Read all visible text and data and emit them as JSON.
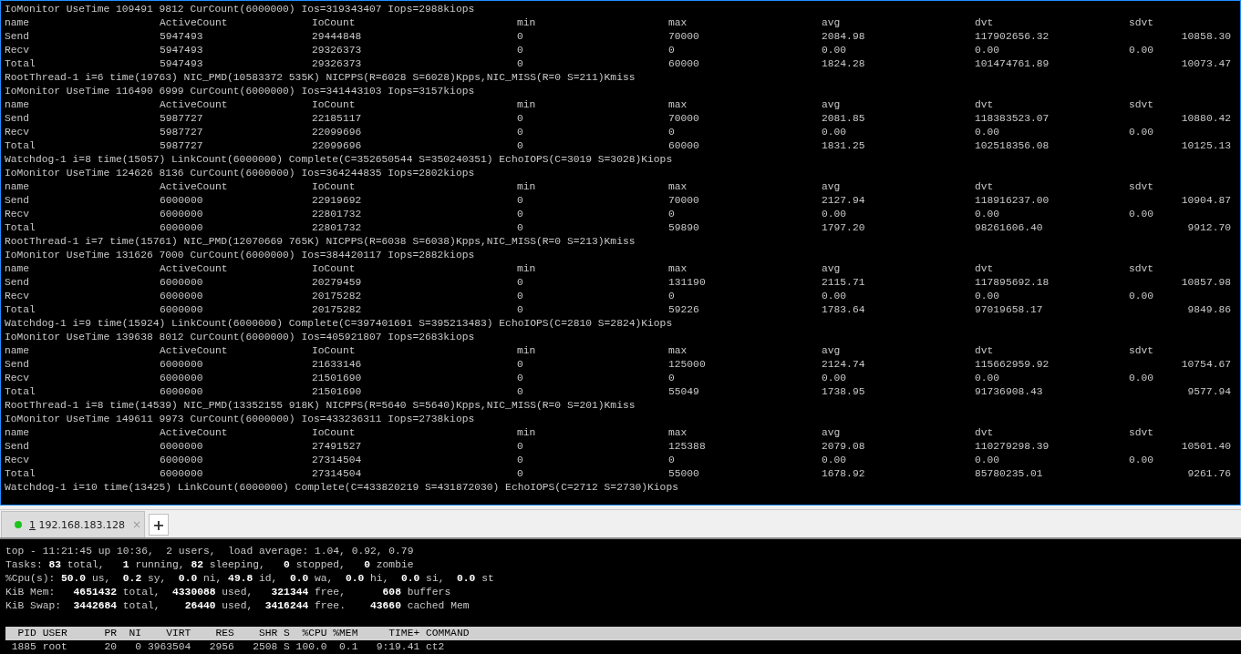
{
  "top_pane": {
    "focused": true,
    "lines": [
      {
        "kind": "text",
        "text": "IoMonitor UseTime 109491 9812 CurCount(6000000) Ios=319343407 Iops=2988kiops"
      },
      {
        "kind": "header",
        "cells": [
          "name",
          "ActiveCount",
          "IoCount",
          "min",
          "max",
          "avg",
          "dvt",
          "sdvt"
        ]
      },
      {
        "kind": "row",
        "cells": [
          "Send",
          "5947493",
          "29444848",
          "0",
          "70000",
          "2084.98",
          "117902656.32"
        ],
        "trailing": "10858.30"
      },
      {
        "kind": "row",
        "cells": [
          "Recv",
          "5947493",
          "29326373",
          "0",
          "0",
          "0.00",
          "0.00",
          "0.00"
        ]
      },
      {
        "kind": "row",
        "cells": [
          "Total",
          "5947493",
          "29326373",
          "0",
          "60000",
          "1824.28",
          "101474761.89"
        ],
        "trailing": "10073.47"
      },
      {
        "kind": "text",
        "text": "RootThread-1 i=6 time(19763) NIC_PMD(10583372 535K) NICPPS(R=6028 S=6028)Kpps,NIC_MISS(R=0 S=211)Kmiss"
      },
      {
        "kind": "text",
        "text": "IoMonitor UseTime 116490 6999 CurCount(6000000) Ios=341443103 Iops=3157kiops"
      },
      {
        "kind": "header",
        "cells": [
          "name",
          "ActiveCount",
          "IoCount",
          "min",
          "max",
          "avg",
          "dvt",
          "sdvt"
        ]
      },
      {
        "kind": "row",
        "cells": [
          "Send",
          "5987727",
          "22185117",
          "0",
          "70000",
          "2081.85",
          "118383523.07"
        ],
        "trailing": "10880.42"
      },
      {
        "kind": "row",
        "cells": [
          "Recv",
          "5987727",
          "22099696",
          "0",
          "0",
          "0.00",
          "0.00",
          "0.00"
        ]
      },
      {
        "kind": "row",
        "cells": [
          "Total",
          "5987727",
          "22099696",
          "0",
          "60000",
          "1831.25",
          "102518356.08"
        ],
        "trailing": "10125.13"
      },
      {
        "kind": "text",
        "text": "Watchdog-1 i=8 time(15057) LinkCount(6000000) Complete(C=352650544 S=350240351) EchoIOPS(C=3019 S=3028)Kiops"
      },
      {
        "kind": "text",
        "text": "IoMonitor UseTime 124626 8136 CurCount(6000000) Ios=364244835 Iops=2802kiops"
      },
      {
        "kind": "header",
        "cells": [
          "name",
          "ActiveCount",
          "IoCount",
          "min",
          "max",
          "avg",
          "dvt",
          "sdvt"
        ]
      },
      {
        "kind": "row",
        "cells": [
          "Send",
          "6000000",
          "22919692",
          "0",
          "70000",
          "2127.94",
          "118916237.00"
        ],
        "trailing": "10904.87"
      },
      {
        "kind": "row",
        "cells": [
          "Recv",
          "6000000",
          "22801732",
          "0",
          "0",
          "0.00",
          "0.00",
          "0.00"
        ]
      },
      {
        "kind": "row",
        "cells": [
          "Total",
          "6000000",
          "22801732",
          "0",
          "59890",
          "1797.20",
          "98261606.40"
        ],
        "trailing": "9912.70"
      },
      {
        "kind": "text",
        "text": "RootThread-1 i=7 time(15761) NIC_PMD(12070669 765K) NICPPS(R=6038 S=6038)Kpps,NIC_MISS(R=0 S=213)Kmiss"
      },
      {
        "kind": "text",
        "text": "IoMonitor UseTime 131626 7000 CurCount(6000000) Ios=384420117 Iops=2882kiops"
      },
      {
        "kind": "header",
        "cells": [
          "name",
          "ActiveCount",
          "IoCount",
          "min",
          "max",
          "avg",
          "dvt",
          "sdvt"
        ]
      },
      {
        "kind": "row",
        "cells": [
          "Send",
          "6000000",
          "20279459",
          "0",
          "131190",
          "2115.71",
          "117895692.18"
        ],
        "trailing": "10857.98"
      },
      {
        "kind": "row",
        "cells": [
          "Recv",
          "6000000",
          "20175282",
          "0",
          "0",
          "0.00",
          "0.00",
          "0.00"
        ]
      },
      {
        "kind": "row",
        "cells": [
          "Total",
          "6000000",
          "20175282",
          "0",
          "59226",
          "1783.64",
          "97019658.17"
        ],
        "trailing": "9849.86"
      },
      {
        "kind": "text",
        "text": "Watchdog-1 i=9 time(15924) LinkCount(6000000) Complete(C=397401691 S=395213483) EchoIOPS(C=2810 S=2824)Kiops"
      },
      {
        "kind": "text",
        "text": "IoMonitor UseTime 139638 8012 CurCount(6000000) Ios=405921807 Iops=2683kiops"
      },
      {
        "kind": "header",
        "cells": [
          "name",
          "ActiveCount",
          "IoCount",
          "min",
          "max",
          "avg",
          "dvt",
          "sdvt"
        ]
      },
      {
        "kind": "row",
        "cells": [
          "Send",
          "6000000",
          "21633146",
          "0",
          "125000",
          "2124.74",
          "115662959.92"
        ],
        "trailing": "10754.67"
      },
      {
        "kind": "row",
        "cells": [
          "Recv",
          "6000000",
          "21501690",
          "0",
          "0",
          "0.00",
          "0.00",
          "0.00"
        ]
      },
      {
        "kind": "row",
        "cells": [
          "Total",
          "6000000",
          "21501690",
          "0",
          "55049",
          "1738.95",
          "91736908.43"
        ],
        "trailing": "9577.94"
      },
      {
        "kind": "text",
        "text": "RootThread-1 i=8 time(14539) NIC_PMD(13352155 918K) NICPPS(R=5640 S=5640)Kpps,NIC_MISS(R=0 S=201)Kmiss"
      },
      {
        "kind": "text",
        "text": "IoMonitor UseTime 149611 9973 CurCount(6000000) Ios=433236311 Iops=2738kiops"
      },
      {
        "kind": "header",
        "cells": [
          "name",
          "ActiveCount",
          "IoCount",
          "min",
          "max",
          "avg",
          "dvt",
          "sdvt"
        ]
      },
      {
        "kind": "row",
        "cells": [
          "Send",
          "6000000",
          "27491527",
          "0",
          "125388",
          "2079.08",
          "110279298.39"
        ],
        "trailing": "10501.40"
      },
      {
        "kind": "row",
        "cells": [
          "Recv",
          "6000000",
          "27314504",
          "0",
          "0",
          "0.00",
          "0.00",
          "0.00"
        ]
      },
      {
        "kind": "row",
        "cells": [
          "Total",
          "6000000",
          "27314504",
          "0",
          "55000",
          "1678.92",
          "85780235.01"
        ],
        "trailing": "9261.76"
      },
      {
        "kind": "text",
        "text": "Watchdog-1 i=10 time(13425) LinkCount(6000000) Complete(C=433820219 S=431872030) EchoIOPS(C=2712 S=2730)Kiops"
      }
    ]
  },
  "session_tabs": [
    {
      "number": "1",
      "host": "192.168.183.128",
      "connected": true,
      "selected": true,
      "close": "×"
    }
  ],
  "new_tab_button": "+",
  "bottom_pane": {
    "summary": [
      "top - 11:21:45 up 10:36,  2 users,  load average: 1.04, 0.92, 0.79",
      "Tasks: **83** total,   **1** running, **82** sleeping,   **0** stopped,   **0** zombie",
      "%Cpu(s): **50.0** us,  **0.2** sy,  **0.0** ni, **49.8** id,  **0.0** wa,  **0.0** hi,  **0.0** si,  **0.0** st",
      "KiB Mem:   **4651432** total,  **4330088** used,   **321344** free,      **608** buffers",
      "KiB Swap:  **3442684** total,    **26440** used,  **3416244** free.    **43660** cached Mem"
    ],
    "process_header": "  PID USER      PR  NI    VIRT    RES    SHR S  %CPU %MEM     TIME+ COMMAND",
    "processes": [
      " 1885 root      20   0 3963504   2956   2508 S 100.0  0.1   9:19.41 ct2"
    ]
  }
}
